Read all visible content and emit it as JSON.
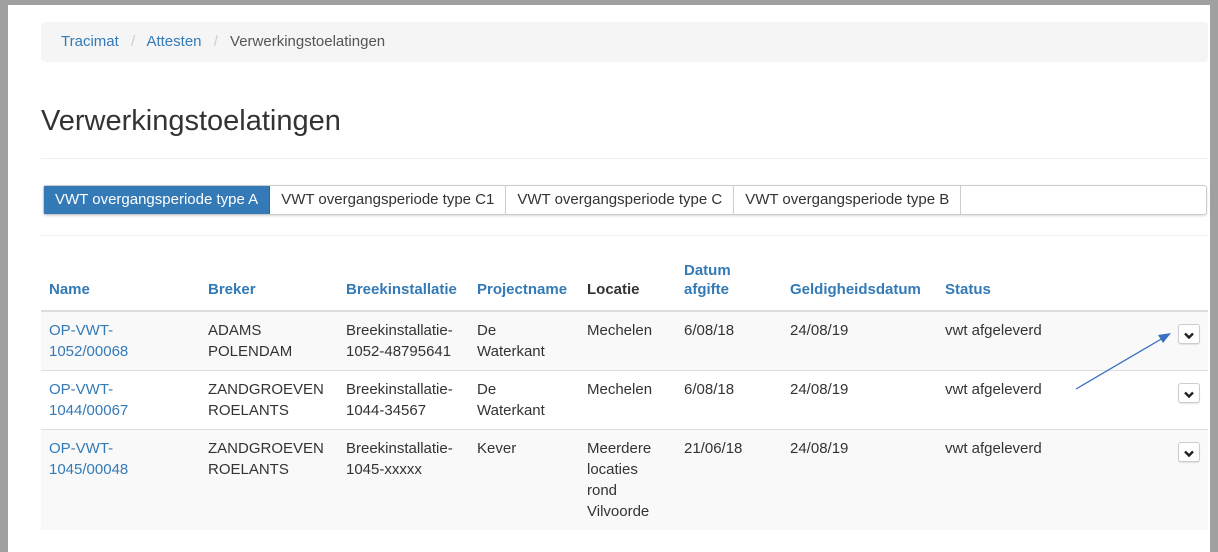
{
  "breadcrumb": {
    "items": [
      "Tracimat",
      "Attesten"
    ],
    "separator": "/",
    "current": "Verwerkingstoelatingen"
  },
  "page_title": "Verwerkingstoelatingen",
  "tabs": [
    {
      "label": "VWT overgangsperiode type A",
      "active": true
    },
    {
      "label": "VWT overgangsperiode type C1",
      "active": false
    },
    {
      "label": "VWT overgangsperiode type C",
      "active": false
    },
    {
      "label": "VWT overgangsperiode type B",
      "active": false
    }
  ],
  "table": {
    "headers": [
      "Name",
      "Breker",
      "Breekinstallatie",
      "Projectname",
      "Locatie",
      "Datum\nafgifte",
      "Geldigheidsdatum",
      "Status"
    ],
    "rows": [
      {
        "name": "OP-VWT-\n1052/00068",
        "breker": "ADAMS\nPOLENDAM",
        "breekinstallatie": "Breekinstallatie-\n1052-48795641",
        "projectname": "De\nWaterkant",
        "locatie": "Mechelen",
        "datum_afgifte": "6/08/18",
        "geldigheidsdatum": "24/08/19",
        "status": "vwt afgeleverd"
      },
      {
        "name": "OP-VWT-\n1044/00067",
        "breker": "ZANDGROEVEN\nROELANTS",
        "breekinstallatie": "Breekinstallatie-\n1044-34567",
        "projectname": "De\nWaterkant",
        "locatie": "Mechelen",
        "datum_afgifte": "6/08/18",
        "geldigheidsdatum": "24/08/19",
        "status": "vwt afgeleverd"
      },
      {
        "name": "OP-VWT-\n1045/00048",
        "breker": "ZANDGROEVEN\nROELANTS",
        "breekinstallatie": "Breekinstallatie-\n1045-xxxxx",
        "projectname": "Kever",
        "locatie": "Meerdere\nlocaties\nrond\nVilvoorde",
        "datum_afgifte": "21/06/18",
        "geldigheidsdatum": "24/08/19",
        "status": "vwt afgeleverd"
      }
    ]
  },
  "colors": {
    "link": "#337ab7",
    "active_tab": "#337ab7",
    "annotation_arrow": "#3a6fc0"
  },
  "icons": {
    "row_action": "chevron-down-icon"
  }
}
